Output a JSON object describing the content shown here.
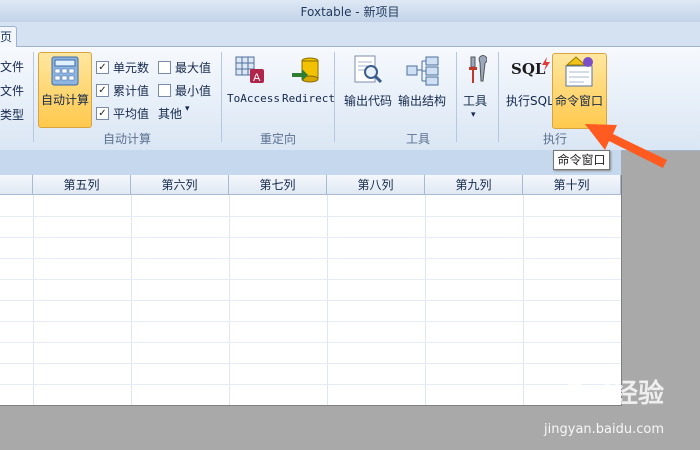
{
  "window": {
    "title": "Foxtable - 新项目"
  },
  "tabs": {
    "active_partial": "页"
  },
  "ribbon": {
    "file_group": {
      "items": [
        "文件",
        "文件",
        "类型"
      ]
    },
    "autocalc": {
      "big_button": "自动计算",
      "checks": [
        {
          "label": "单元数",
          "checked": true
        },
        {
          "label": "累计值",
          "checked": true
        },
        {
          "label": "平均值",
          "checked": true
        },
        {
          "label": "最大值",
          "checked": false
        },
        {
          "label": "最小值",
          "checked": false
        }
      ],
      "other_label": "其他",
      "group_label": "自动计算"
    },
    "redirect": {
      "toaccess": "ToAccess",
      "redirect": "Redirect",
      "group_label": "重定向"
    },
    "tools": {
      "export_code": "输出代码",
      "export_struct": "输出结构",
      "tools": "工具",
      "group_label": "工具"
    },
    "execute": {
      "sql_icon_text": "SQL",
      "exec_sql": "执行SQL",
      "cmd_window": "命令窗口",
      "group_label": "执行"
    }
  },
  "tooltip": {
    "text": "命令窗口"
  },
  "grid": {
    "columns": [
      "第五列",
      "第六列",
      "第七列",
      "第八列",
      "第九列",
      "第十列"
    ]
  },
  "watermark": {
    "brand": "Bai经验",
    "url": "jingyan.baidu.com"
  },
  "colors": {
    "active_button": "#ffc94d",
    "arrow": "#ff5a1f"
  }
}
